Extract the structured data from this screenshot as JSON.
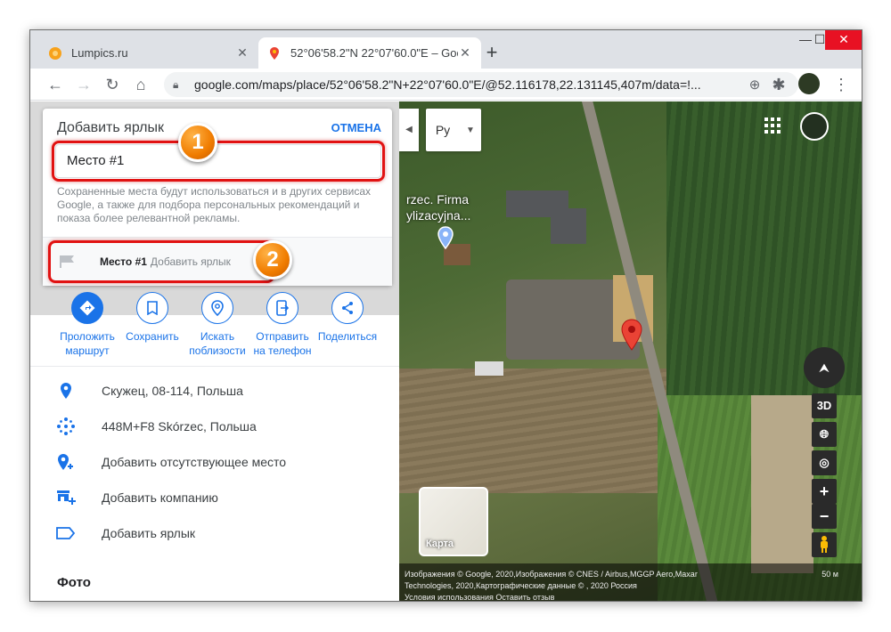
{
  "browser": {
    "tabs": [
      {
        "title": "Lumpics.ru",
        "favicon": "orange-circle-icon"
      },
      {
        "title": "52°06'58.2\"N 22°07'60.0\"E – Goo",
        "favicon": "google-maps-pin-icon"
      }
    ],
    "new_tab": "+",
    "url": "google.com/maps/place/52°06'58.2\"N+22°07'60.0\"E/@52.116178,22.131145,407m/data=!..."
  },
  "label_card": {
    "title": "Добавить ярлык",
    "cancel": "ОТМЕНА",
    "input_value": "Место #1",
    "hint": "Сохраненные места будут использоваться и в других сервисах Google, а также для подбора персональных рекомендаций и показа более релевантной рекламы.",
    "suggestion_name": "Место #1",
    "suggestion_sub": "Добавить ярлык"
  },
  "markers": {
    "one": "1",
    "two": "2"
  },
  "actions": [
    {
      "label": "Проложить маршрут",
      "icon": "directions-icon"
    },
    {
      "label": "Сохранить",
      "icon": "bookmark-icon"
    },
    {
      "label": "Искать поблизости",
      "icon": "nearby-icon"
    },
    {
      "label": "Отправить на телефон",
      "icon": "send-to-phone-icon"
    },
    {
      "label": "Поделиться",
      "icon": "share-icon"
    }
  ],
  "info": [
    {
      "text": "Скужец, 08-114, Польша",
      "icon": "location-pin-icon"
    },
    {
      "text": "448M+F8 Skórzec, Польша",
      "icon": "plus-code-icon"
    },
    {
      "text": "Добавить отсутствующее место",
      "icon": "add-place-icon"
    },
    {
      "text": "Добавить компанию",
      "icon": "add-business-icon"
    },
    {
      "text": "Добавить ярлык",
      "icon": "label-icon"
    }
  ],
  "photos_heading": "Фото",
  "map": {
    "language": "Ру",
    "place_label_line1": "rzec. Firma",
    "place_label_line2": "ylizacyjna...",
    "ctrl_3d": "3D",
    "zoom_in": "+",
    "zoom_out": "−",
    "layer_thumb_label": "Карта",
    "attribution_line1": "Изображения © Google, 2020,Изображения © CNES / Airbus,MGGP Aero,Maxar",
    "attribution_line2": "Technologies, 2020,Картографические данные © , 2020    Россия",
    "attribution_line3": "Условия использования      Оставить отзыв",
    "scale": "50 м"
  }
}
